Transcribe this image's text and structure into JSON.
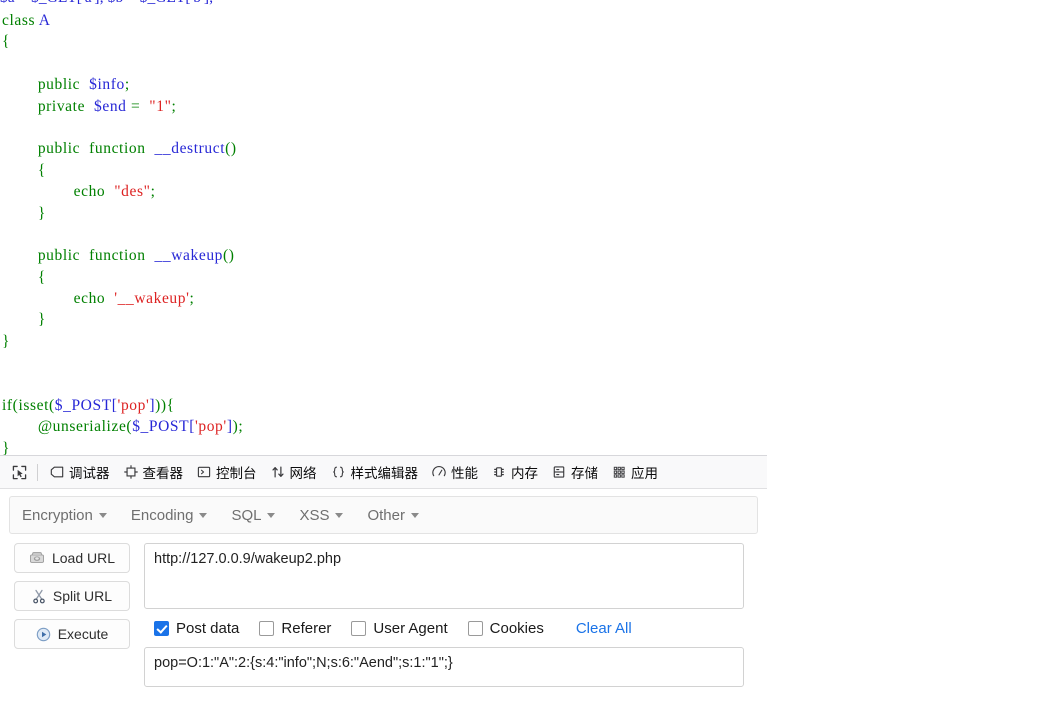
{
  "code": {
    "language": "php",
    "clipped_top_line": "$a = $_GET['a']; $b = $_GET['b'];",
    "lines": [
      [
        {
          "t": "class",
          "c": "k"
        },
        {
          "t": " ",
          "c": "p"
        },
        {
          "t": "A",
          "c": "v"
        }
      ],
      [
        {
          "t": "{",
          "c": "p"
        }
      ],
      [],
      [
        {
          "t": "        ",
          "c": "p"
        },
        {
          "t": "public",
          "c": "k"
        },
        {
          "t": "  ",
          "c": "p"
        },
        {
          "t": "$info",
          "c": "v"
        },
        {
          "t": ";",
          "c": "p"
        }
      ],
      [
        {
          "t": "        ",
          "c": "p"
        },
        {
          "t": "private",
          "c": "k"
        },
        {
          "t": "  ",
          "c": "p"
        },
        {
          "t": "$end",
          "c": "v"
        },
        {
          "t": " = ",
          "c": "p"
        },
        {
          "t": " \"1\"",
          "c": "s"
        },
        {
          "t": ";",
          "c": "p"
        }
      ],
      [],
      [
        {
          "t": "        ",
          "c": "p"
        },
        {
          "t": "public",
          "c": "k"
        },
        {
          "t": "  ",
          "c": "p"
        },
        {
          "t": "function",
          "c": "k"
        },
        {
          "t": "  ",
          "c": "p"
        },
        {
          "t": "__destruct",
          "c": "fn"
        },
        {
          "t": "()",
          "c": "p"
        }
      ],
      [
        {
          "t": "        ",
          "c": "p"
        },
        {
          "t": "{",
          "c": "p"
        }
      ],
      [
        {
          "t": "                ",
          "c": "p"
        },
        {
          "t": "echo",
          "c": "k"
        },
        {
          "t": "  ",
          "c": "p"
        },
        {
          "t": "\"des\"",
          "c": "s"
        },
        {
          "t": ";",
          "c": "p"
        }
      ],
      [
        {
          "t": "        ",
          "c": "p"
        },
        {
          "t": "}",
          "c": "p"
        }
      ],
      [],
      [
        {
          "t": "        ",
          "c": "p"
        },
        {
          "t": "public",
          "c": "k"
        },
        {
          "t": "  ",
          "c": "p"
        },
        {
          "t": "function",
          "c": "k"
        },
        {
          "t": "  ",
          "c": "p"
        },
        {
          "t": "__wakeup",
          "c": "fn"
        },
        {
          "t": "()",
          "c": "p"
        }
      ],
      [
        {
          "t": "        ",
          "c": "p"
        },
        {
          "t": "{",
          "c": "p"
        }
      ],
      [
        {
          "t": "                ",
          "c": "p"
        },
        {
          "t": "echo",
          "c": "k"
        },
        {
          "t": "  ",
          "c": "p"
        },
        {
          "t": "'__wakeup'",
          "c": "s"
        },
        {
          "t": ";",
          "c": "p"
        }
      ],
      [
        {
          "t": "        ",
          "c": "p"
        },
        {
          "t": "}",
          "c": "p"
        }
      ],
      [
        {
          "t": "}",
          "c": "p"
        }
      ],
      [],
      [],
      [
        {
          "t": "if",
          "c": "k"
        },
        {
          "t": "(",
          "c": "p"
        },
        {
          "t": "isset",
          "c": "k"
        },
        {
          "t": "(",
          "c": "p"
        },
        {
          "t": "$_POST",
          "c": "v"
        },
        {
          "t": "[",
          "c": "b"
        },
        {
          "t": "'pop'",
          "c": "s"
        },
        {
          "t": "]",
          "c": "b"
        },
        {
          "t": ")){",
          "c": "p"
        }
      ],
      [
        {
          "t": "        ",
          "c": "p"
        },
        {
          "t": "@unserialize",
          "c": "k"
        },
        {
          "t": "(",
          "c": "p"
        },
        {
          "t": "$_POST",
          "c": "v"
        },
        {
          "t": "[",
          "c": "b"
        },
        {
          "t": "'pop'",
          "c": "s"
        },
        {
          "t": "]",
          "c": "b"
        },
        {
          "t": ");",
          "c": "p"
        }
      ],
      [
        {
          "t": "}",
          "c": "p"
        }
      ]
    ]
  },
  "devtools": {
    "picker_icon": "element-picker-icon",
    "tabs": [
      {
        "label": "调试器",
        "icon": "debugger-icon"
      },
      {
        "label": "查看器",
        "icon": "inspector-icon"
      },
      {
        "label": "控制台",
        "icon": "console-icon"
      },
      {
        "label": "网络",
        "icon": "network-icon"
      },
      {
        "label": "样式编辑器",
        "icon": "style-editor-icon"
      },
      {
        "label": "性能",
        "icon": "performance-icon"
      },
      {
        "label": "内存",
        "icon": "memory-icon"
      },
      {
        "label": "存储",
        "icon": "storage-icon"
      },
      {
        "label": "应用",
        "icon": "application-icon"
      }
    ]
  },
  "hackbar": {
    "menus": [
      {
        "label": "Encryption"
      },
      {
        "label": "Encoding"
      },
      {
        "label": "SQL"
      },
      {
        "label": "XSS"
      },
      {
        "label": "Other"
      }
    ],
    "buttons": [
      {
        "label": "Load URL",
        "icon": "load-url-icon"
      },
      {
        "label": "Split URL",
        "icon": "scissors-icon"
      },
      {
        "label": "Execute",
        "icon": "play-icon"
      }
    ],
    "url_value": "http://127.0.0.9/wakeup2.php",
    "post_value": "pop=O:1:\"A\":2:{s:4:\"info\";N;s:6:\"Aend\";s:1:\"1\";}",
    "checkboxes": [
      {
        "label": "Post data",
        "checked": true
      },
      {
        "label": "Referer",
        "checked": false
      },
      {
        "label": "User Agent",
        "checked": false
      },
      {
        "label": "Cookies",
        "checked": false
      }
    ],
    "clear_all_label": "Clear All",
    "accent_color": "#1a73e8"
  },
  "colors": {
    "keyword": "#008000",
    "variable": "#2727d6",
    "string": "#dd2222",
    "devtools_bg": "#f9f9fa",
    "page_bg": "#ffffff"
  }
}
